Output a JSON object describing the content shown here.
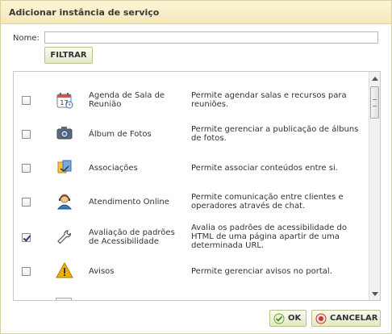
{
  "dialog": {
    "title": "Adicionar instância de serviço",
    "name_label": "Nome:",
    "name_value": "",
    "filter_label": "FILTRAR",
    "ok_label": "OK",
    "cancel_label": "CANCELAR"
  },
  "services": [
    {
      "name": "Agenda de Sala de Reunião",
      "description": "Permite agendar salas e recursos para reuniões.",
      "checked": false,
      "icon": "calendar-icon"
    },
    {
      "name": "Álbum de Fotos",
      "description": "Permite gerenciar a publicação de álbuns de fotos.",
      "checked": false,
      "icon": "camera-icon"
    },
    {
      "name": "Associações",
      "description": "Permite associar conteúdos entre si.",
      "checked": false,
      "icon": "association-icon"
    },
    {
      "name": "Atendimento Online",
      "description": "Permite comunicação entre clientes e operadores através de chat.",
      "checked": false,
      "icon": "support-agent-icon"
    },
    {
      "name": "Avaliação de padrões de Acessibilidade",
      "description": "Avalia os padrões de acessibilidade do HTML de uma página apartir de uma determinada URL.",
      "checked": true,
      "icon": "wrench-icon"
    },
    {
      "name": "Avisos",
      "description": "Permite gerenciar avisos no portal.",
      "checked": false,
      "icon": "warning-icon"
    }
  ],
  "colors": {
    "title_bar": "#f4e8b9",
    "button_bg": "#e3e8c7",
    "ok_check": "#6aa32c",
    "cancel_icon": "#c0392b",
    "warning": "#f2b100"
  }
}
